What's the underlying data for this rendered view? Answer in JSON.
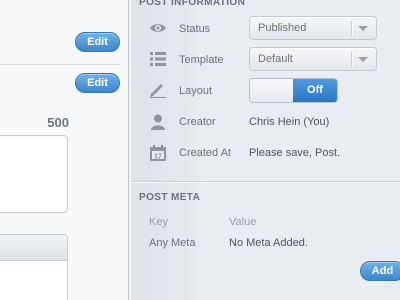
{
  "left_panel": {
    "edit_button_1": "Edit",
    "edit_button_2": "Edit",
    "char_count": "500"
  },
  "post_information": {
    "title": "POST INFORMATION",
    "status": {
      "label": "Status",
      "value": "Published",
      "icon": "eye-icon"
    },
    "template": {
      "label": "Template",
      "value": "Default",
      "icon": "list-icon"
    },
    "layout": {
      "label": "Layout",
      "toggle_value": "Off",
      "icon": "pencil-icon"
    },
    "creator": {
      "label": "Creator",
      "value": "Chris Hein (You)",
      "icon": "user-icon"
    },
    "created_at": {
      "label": "Created At",
      "value": "Please save, Post.",
      "icon": "calendar-icon"
    }
  },
  "post_meta": {
    "title": "POST META",
    "columns": {
      "key": "Key",
      "value": "Value"
    },
    "rows": [
      {
        "key": "Any Meta",
        "value": "No Meta Added."
      }
    ],
    "add_button": "Add"
  },
  "colors": {
    "accent": "#3d86cc",
    "panel_bg": "#e9ecf0",
    "text": "#6b727d"
  }
}
